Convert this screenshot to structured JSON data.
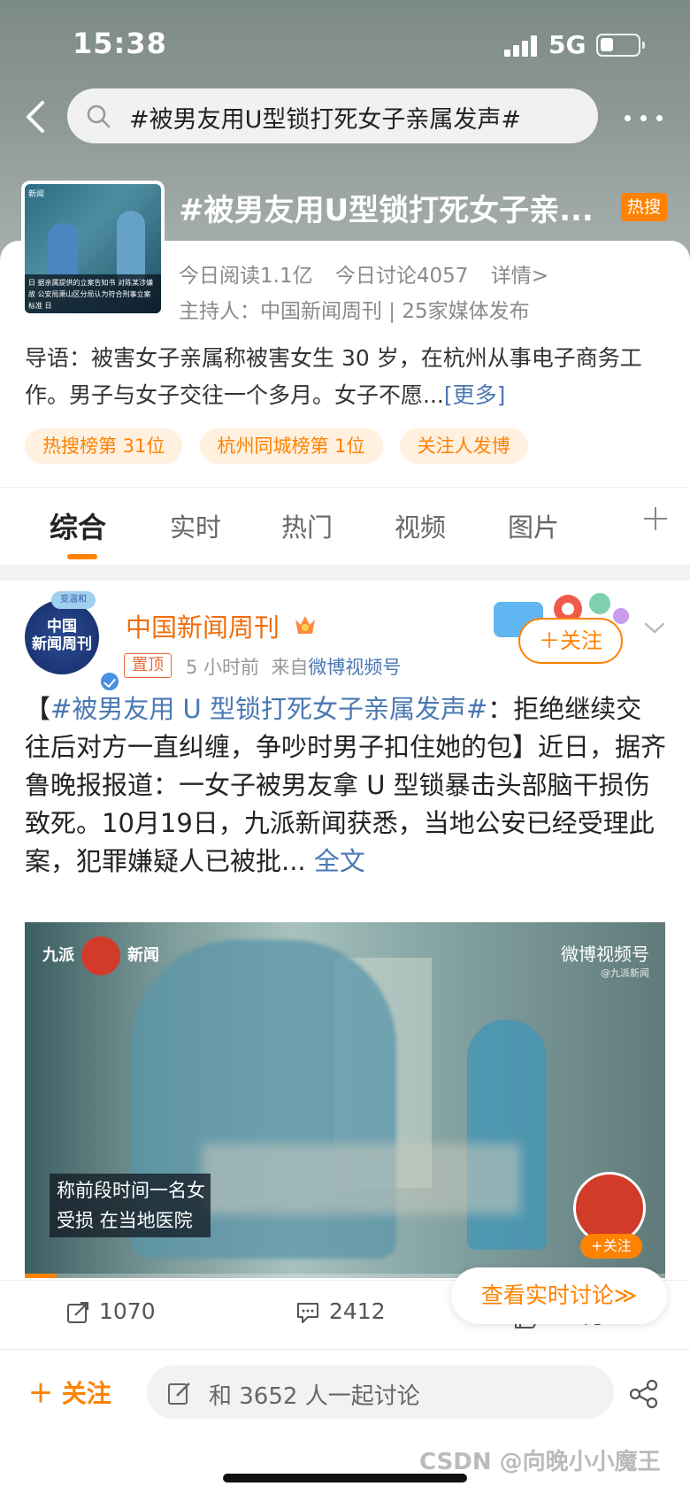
{
  "status_bar": {
    "time": "15:38",
    "network": "5G"
  },
  "search": {
    "query": "#被男友用U型锁打死女子亲属发声#"
  },
  "topic": {
    "title": "#被男友用U型锁打死女子亲...",
    "hot_badge": "热搜",
    "thumb_label": "新闻",
    "thumb_caption": "日 据亲属提供的立案告知书 对陈某涉嫌故 公安局萧山区分局认为符合刑事立案标准 日",
    "stats": {
      "reads": "今日阅读1.1亿",
      "discussions": "今日讨论4057",
      "details": "详情>"
    },
    "host": "主持人：中国新闻周刊 | 25家媒体发布",
    "intro": "导语：被害女子亲属称被害女生 30 岁，在杭州从事电子商务工作。男子与女子交往一个多月。女子不愿...",
    "intro_more": "[更多]",
    "tags": [
      "热搜榜第 31位",
      "杭州同城榜第 1位",
      "关注人发博"
    ]
  },
  "tabs": [
    "综合",
    "实时",
    "热门",
    "视频",
    "图片"
  ],
  "post": {
    "avatar_text": "中国\n新闻周刊",
    "avatar_badge": "变温和",
    "author": "中国新闻周刊",
    "pin": "置顶",
    "time": "5 小时前",
    "source_prefix": "来自",
    "source": "微博视频号",
    "follow": "＋关注",
    "text_open": "【",
    "hashtag": "#被男友用 U 型锁打死女子亲属发声#",
    "text_body": "：拒绝继续交往后对方一直纠缠，争吵时男子扣住她的包】近日，据齐鲁晚报报道：一女子被男友拿 U 型锁暴击头部脑干损伤致死。10月19日，九派新闻获悉，当地公安已经受理此案，犯罪嫌疑人已被批...",
    "full_text": " 全文",
    "video": {
      "logo_left": "九派",
      "logo_right": "新闻",
      "watermark": "微博视频号",
      "watermark_sub": "@九派新闻",
      "subtitle_line1": "称前段时间一名女",
      "subtitle_line2": "受损 在当地医院",
      "follow": "+关注",
      "progress": 0.05
    },
    "realtime_button": "查看实时讨论≫",
    "actions": {
      "reposts": "1070",
      "comments": "2412",
      "likes": "8.9万"
    }
  },
  "bottom_bar": {
    "follow": "＋ 关注",
    "input_placeholder": "和 3652 人一起讨论",
    "watermark": "CSDN @向晚小小魔王"
  },
  "colors": {
    "accent": "#ff8200",
    "link": "#4a78b3",
    "author": "#f26d0a"
  }
}
